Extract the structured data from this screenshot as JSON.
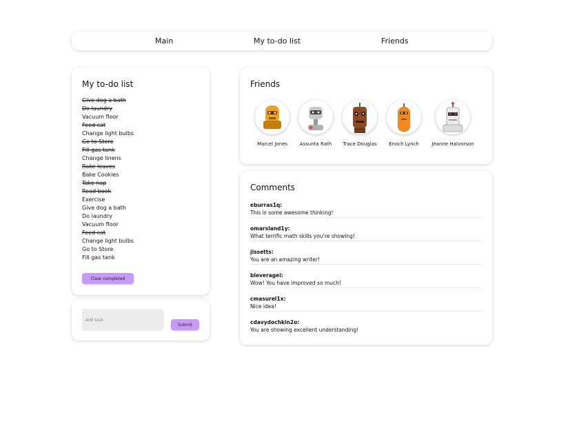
{
  "nav": {
    "items": [
      "Main",
      "My to-do list",
      "Friends"
    ]
  },
  "todo": {
    "title": "My to-do list",
    "items": [
      {
        "text": "Give dog a bath",
        "done": true
      },
      {
        "text": "Do laundry",
        "done": true
      },
      {
        "text": "Vacuum floor",
        "done": false
      },
      {
        "text": "Feed cat",
        "done": true
      },
      {
        "text": "Change light bulbs",
        "done": false
      },
      {
        "text": "Go to Store",
        "done": true
      },
      {
        "text": "Fill gas tank",
        "done": true
      },
      {
        "text": "Change linens",
        "done": false
      },
      {
        "text": "Rake leaves",
        "done": true
      },
      {
        "text": "Bake Cookies",
        "done": false
      },
      {
        "text": "Take nap",
        "done": true
      },
      {
        "text": "Read book",
        "done": true
      },
      {
        "text": "Exercise",
        "done": false
      },
      {
        "text": "Give dog a bath",
        "done": false
      },
      {
        "text": "Do laundry",
        "done": false
      },
      {
        "text": "Vacuum floor",
        "done": false
      },
      {
        "text": "Feed cat",
        "done": true
      },
      {
        "text": "Change light bulbs",
        "done": false
      },
      {
        "text": "Go to Store",
        "done": false
      },
      {
        "text": "Fill gas tank",
        "done": false
      }
    ],
    "clear_label": "Clear completed"
  },
  "add_task": {
    "placeholder": "Add task",
    "value": "",
    "submit_label": "Submit"
  },
  "friends": {
    "title": "Friends",
    "people": [
      {
        "name": "Marcel Jones",
        "icon": "orange-robot-avatar"
      },
      {
        "name": "Assunta Rath",
        "icon": "gray-robot-avatar"
      },
      {
        "name": "Trace Douglas",
        "icon": "brown-robot-avatar"
      },
      {
        "name": "Enoch Lynch",
        "icon": "orange-robot-avatar"
      },
      {
        "name": "Jeanne Halvorson",
        "icon": "white-robot-avatar"
      }
    ]
  },
  "comments": {
    "title": "Comments",
    "items": [
      {
        "user": "eburras1q:",
        "text": "This is some awesome thinking!"
      },
      {
        "user": "omarsland1y:",
        "text": "What terrific math skills you’re showing!"
      },
      {
        "user": "jissetts:",
        "text": "You are an amazing writer!"
      },
      {
        "user": "bleveragei:",
        "text": "Wow! You have improved so much!"
      },
      {
        "user": "cmasurel1x:",
        "text": "Nice idea!"
      },
      {
        "user": "cdavydochkin2o:",
        "text": "You are showing excellent understanding!"
      }
    ]
  },
  "colors": {
    "accent": "#c89af8",
    "input_bg": "#ececec"
  }
}
